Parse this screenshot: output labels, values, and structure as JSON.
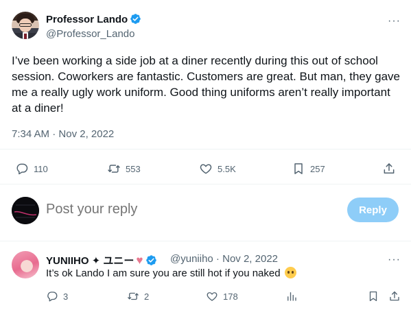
{
  "tweet": {
    "author_name": "Professor Lando",
    "author_handle": "@Professor_Lando",
    "more_label": "···",
    "text": "I’ve been working a side job at a diner recently during this out of school session. Coworkers are fantastic. Customers are great. But man, they gave me a really ugly work uniform. Good thing uniforms aren’t really important at a diner!",
    "time": "7:34 AM",
    "date": "Nov 2, 2022",
    "meta_separator": " · ",
    "stats": {
      "replies": "110",
      "reposts": "553",
      "likes": "5.5K",
      "bookmarks": "257"
    }
  },
  "composer": {
    "placeholder": "Post your reply",
    "button_label": "Reply"
  },
  "reply": {
    "author_name": "YUNIIHO ✦ ユニー",
    "author_handle": "@yuniiho",
    "date": "Nov 2, 2022",
    "separator": " · ",
    "more_label": "···",
    "text": "It’s ok Lando I am sure you are still hot if you naked",
    "stats": {
      "replies": "3",
      "reposts": "2",
      "likes": "178"
    }
  },
  "colors": {
    "accent": "#1d9bf0",
    "reply_button": "#8ecdf8",
    "secondary_text": "#536471",
    "divider": "#eff3f4",
    "heart_emoji": "#e8788f"
  },
  "icons": [
    "verified-badge-icon",
    "reply-icon",
    "repost-icon",
    "like-icon",
    "bookmark-icon",
    "share-icon",
    "views-icon",
    "more-icon"
  ]
}
